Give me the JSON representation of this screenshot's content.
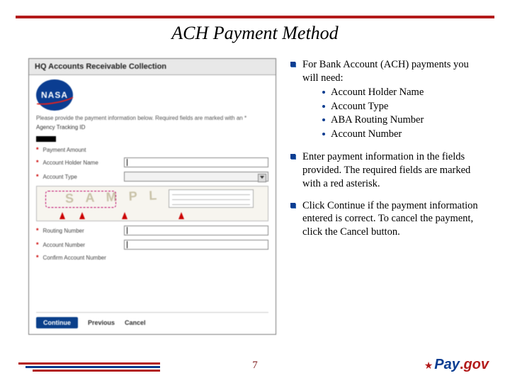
{
  "title": "ACH Payment Method",
  "screenshot": {
    "panel_title": "HQ Accounts Receivable Collection",
    "instruction": "Please provide the payment information below. Required fields are marked with an *",
    "tracking_label": "Agency Tracking ID",
    "fields": {
      "payment_amount": "Payment Amount",
      "account_holder": "Account Holder Name",
      "account_type": "Account Type",
      "routing": "Routing Number",
      "account_number": "Account Number",
      "confirm_account": "Confirm Account Number"
    },
    "buttons": {
      "continue": "Continue",
      "previous": "Previous",
      "cancel": "Cancel"
    },
    "sample_text": "S A M P L E"
  },
  "bullets": {
    "intro": "For Bank Account (ACH) payments you will need:",
    "needs": [
      "Account Holder Name",
      "Account Type",
      "ABA Routing Number",
      "Account Number"
    ],
    "p2": "Enter payment information in the fields provided. The required fields are marked with a red asterisk.",
    "p3": "Click Continue if the payment information entered is correct. To cancel the payment, click the Cancel button."
  },
  "footer": {
    "page": "7",
    "brand_pay": "Pay",
    "brand_gov": "gov"
  }
}
